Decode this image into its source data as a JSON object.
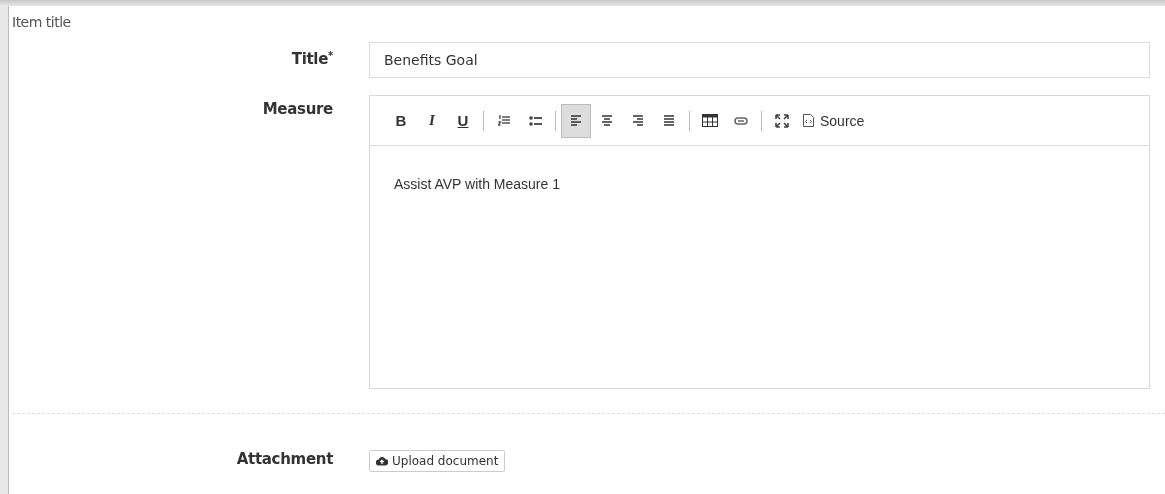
{
  "section": {
    "title": "Item title"
  },
  "title_field": {
    "label": "Title",
    "required_mark": "*",
    "value": "Benefits Goal"
  },
  "measure_field": {
    "label": "Measure",
    "toolbar": [
      [
        {
          "kind": "bold",
          "pressed": false,
          "label": "B"
        },
        {
          "kind": "italic",
          "pressed": false,
          "label": "I"
        },
        {
          "kind": "underline",
          "pressed": false,
          "label": "U"
        }
      ],
      [
        {
          "kind": "numbered-list",
          "pressed": false
        },
        {
          "kind": "bullet-list",
          "pressed": false
        }
      ],
      [
        {
          "kind": "align-left",
          "pressed": true
        },
        {
          "kind": "align-center",
          "pressed": false
        },
        {
          "kind": "align-right",
          "pressed": false
        },
        {
          "kind": "justify",
          "pressed": false
        }
      ],
      [
        {
          "kind": "table",
          "pressed": false
        },
        {
          "kind": "link",
          "pressed": false
        }
      ],
      [
        {
          "kind": "maximize",
          "pressed": false
        },
        {
          "kind": "source",
          "pressed": false,
          "label": "Source"
        }
      ]
    ],
    "content": "Assist AVP with Measure 1"
  },
  "attachment": {
    "label": "Attachment",
    "button": "Upload document"
  }
}
